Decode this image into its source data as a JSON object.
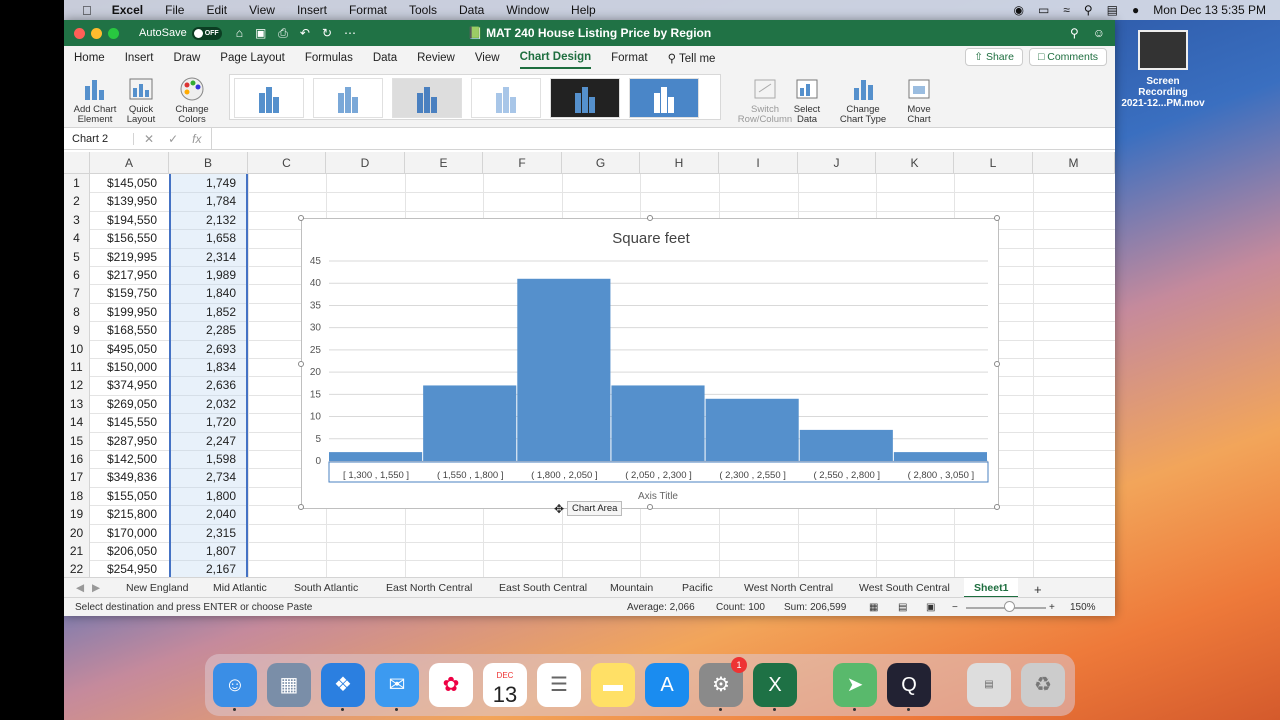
{
  "menubar": {
    "apple": "",
    "app": "Excel",
    "items": [
      "File",
      "Edit",
      "View",
      "Insert",
      "Format",
      "Tools",
      "Data",
      "Window",
      "Help"
    ],
    "clock": "Mon Dec 13  5:35 PM"
  },
  "titlebar": {
    "autosave_label": "AutoSave",
    "autosave_state": "OFF",
    "doc_title": "MAT 240 House Listing Price by Region"
  },
  "tabs": [
    "Home",
    "Insert",
    "Draw",
    "Page Layout",
    "Formulas",
    "Data",
    "Review",
    "View",
    "Chart Design",
    "Format",
    "Tell me"
  ],
  "tab_active": "Chart Design",
  "share_label": "Share",
  "comments_label": "Comments",
  "ribbon": {
    "add_chart_element": "Add Chart\nElement",
    "quick_layout": "Quick\nLayout",
    "change_colors": "Change\nColors",
    "switch_row_col": "Switch\nRow/Column",
    "select_data": "Select\nData",
    "change_chart_type": "Change\nChart Type",
    "move_chart": "Move\nChart"
  },
  "formula_bar": {
    "name_box": "Chart 2",
    "fx": "fx"
  },
  "columns": [
    "A",
    "B",
    "C",
    "D",
    "E",
    "F",
    "G",
    "H",
    "I",
    "J",
    "K",
    "L",
    "M"
  ],
  "rows": [
    {
      "n": "1",
      "a": "$145,050",
      "b": "1,749"
    },
    {
      "n": "2",
      "a": "$139,950",
      "b": "1,784"
    },
    {
      "n": "3",
      "a": "$194,550",
      "b": "2,132"
    },
    {
      "n": "4",
      "a": "$156,550",
      "b": "1,658"
    },
    {
      "n": "5",
      "a": "$219,995",
      "b": "2,314"
    },
    {
      "n": "6",
      "a": "$217,950",
      "b": "1,989"
    },
    {
      "n": "7",
      "a": "$159,750",
      "b": "1,840"
    },
    {
      "n": "8",
      "a": "$199,950",
      "b": "1,852"
    },
    {
      "n": "9",
      "a": "$168,550",
      "b": "2,285"
    },
    {
      "n": "10",
      "a": "$495,050",
      "b": "2,693"
    },
    {
      "n": "11",
      "a": "$150,000",
      "b": "1,834"
    },
    {
      "n": "12",
      "a": "$374,950",
      "b": "2,636"
    },
    {
      "n": "13",
      "a": "$269,050",
      "b": "2,032"
    },
    {
      "n": "14",
      "a": "$145,550",
      "b": "1,720"
    },
    {
      "n": "15",
      "a": "$287,950",
      "b": "2,247"
    },
    {
      "n": "16",
      "a": "$142,500",
      "b": "1,598"
    },
    {
      "n": "17",
      "a": "$349,836",
      "b": "2,734"
    },
    {
      "n": "18",
      "a": "$155,050",
      "b": "1,800"
    },
    {
      "n": "19",
      "a": "$215,800",
      "b": "2,040"
    },
    {
      "n": "20",
      "a": "$170,000",
      "b": "2,315"
    },
    {
      "n": "21",
      "a": "$206,050",
      "b": "1,807"
    },
    {
      "n": "22",
      "a": "$254,950",
      "b": "2,167"
    }
  ],
  "chart_data": {
    "type": "bar",
    "title": "Square feet",
    "xlabel": "Axis Title",
    "ylabel": "",
    "categories": [
      "[ 1,300 ,  1,550 ]",
      "( 1,550 ,  1,800 ]",
      "( 1,800 ,  2,050 ]",
      "( 2,050 ,  2,300 ]",
      "( 2,300 ,  2,550 ]",
      "( 2,550 ,  2,800 ]",
      "( 2,800 ,  3,050 ]"
    ],
    "values": [
      2,
      17,
      41,
      17,
      14,
      7,
      2
    ],
    "ylim": [
      0,
      45
    ],
    "yticks": [
      "0",
      "5",
      "10",
      "15",
      "20",
      "25",
      "30",
      "35",
      "40",
      "45"
    ],
    "grid": true,
    "bar_color": "#5590cc"
  },
  "tooltip": "Chart Area",
  "sheet_tabs": [
    "New England",
    "Mid Atlantic",
    "South Atlantic",
    "East North Central",
    "East South Central",
    "Mountain",
    "Pacific",
    "West North Central",
    "West South Central",
    "Sheet1"
  ],
  "sheet_active": "Sheet1",
  "status": {
    "message": "Select destination and press ENTER or choose Paste",
    "average": "Average:  2,066",
    "count": "Count:  100",
    "sum": "Sum:  206,599",
    "zoom": "150%"
  },
  "desktop_file": "Screen Recording\n2021-12...PM.mov",
  "dock_calendar": {
    "month": "DEC",
    "day": "13"
  },
  "dock_badge": "1"
}
